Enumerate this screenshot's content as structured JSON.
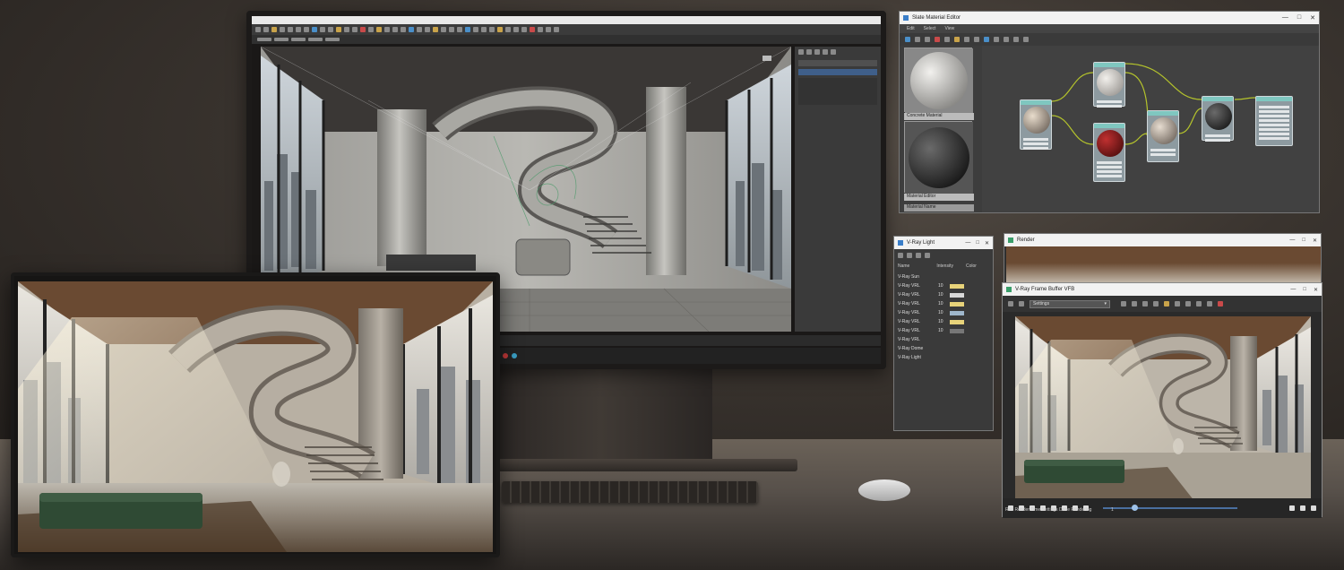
{
  "max_app": {
    "title": "",
    "toolbar_icon_count": 48
  },
  "material_editor": {
    "title": "Slate Material Editor",
    "menu": [
      "Edit",
      "Select",
      "View"
    ],
    "slot1_label": "Concrete Material",
    "slot2_label": "Material Editor",
    "bottom_label": "Material Name"
  },
  "light_lister": {
    "title": "V-Ray Light",
    "col_name": "Name",
    "col_intensity": "Intensity",
    "col_color": "Color",
    "rows": [
      {
        "name": "V-Ray Sun",
        "val": "",
        "color": ""
      },
      {
        "name": "V-Ray VRL",
        "val": "10",
        "color": "#e8d37a"
      },
      {
        "name": "V-Ray VRL",
        "val": "10",
        "color": "#d8d8d8"
      },
      {
        "name": "V-Ray VRL",
        "val": "10",
        "color": "#e8d37a"
      },
      {
        "name": "V-Ray VRL",
        "val": "10",
        "color": "#9fb7cc"
      },
      {
        "name": "V-Ray VRL",
        "val": "10",
        "color": "#e8d37a"
      },
      {
        "name": "V-Ray VRL",
        "val": "10",
        "color": "#777777"
      },
      {
        "name": "V-Ray VRL",
        "val": "",
        "color": ""
      },
      {
        "name": "V-Ray Dome",
        "val": "",
        "color": ""
      },
      {
        "name": "V-Ray Light",
        "val": "",
        "color": ""
      }
    ]
  },
  "render_window": {
    "title": "Render"
  },
  "vfb": {
    "title": "V-Ray Frame Buffer VFB",
    "dropdown": "Settings",
    "status": "Red Render Time Settings Done Rendering",
    "status2": "1"
  },
  "colors": {
    "accent_green": "#2f4a34",
    "node_teal": "#7fc7c0",
    "wire": "#b4c32c",
    "material_red": "#7a1616"
  }
}
